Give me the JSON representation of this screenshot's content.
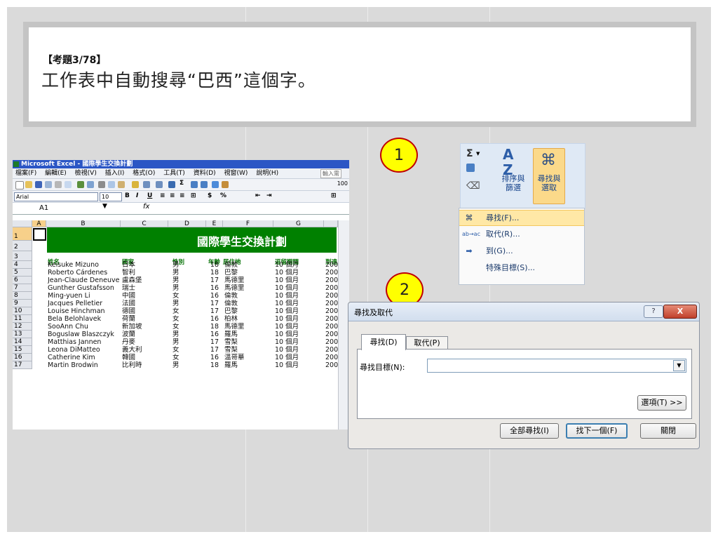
{
  "question": {
    "number": "【考題3/78】",
    "text": "工作表中自動搜尋“巴西”這個字。"
  },
  "callouts": [
    "1",
    "2"
  ],
  "excel": {
    "window_title": "Microsoft Excel - 國際學生交換計劃",
    "menu": [
      "檔案(F)",
      "編輯(E)",
      "檢視(V)",
      "插入(I)",
      "格式(O)",
      "工具(T)",
      "資料(D)",
      "視窗(W)",
      "說明(H)"
    ],
    "help_box": "輸入需",
    "zoom": "100",
    "font_name": "Arial",
    "font_size": "10",
    "name_box": "A1",
    "fx": "fx",
    "columns": [
      "A",
      "B",
      "C",
      "D",
      "E",
      "F",
      "G"
    ],
    "rows": [
      "1",
      "2",
      "3",
      "4",
      "5",
      "6",
      "7",
      "8",
      "9",
      "10",
      "11",
      "12",
      "13",
      "14",
      "15",
      "16",
      "17"
    ],
    "banner": "國際學生交換計劃",
    "headers": [
      "姓名",
      "國家",
      "性別",
      "年齡",
      "居住地",
      "逗留期間",
      "到達"
    ],
    "data": [
      [
        "Keisuke Mizuno",
        "日本",
        "男",
        "18",
        "倫敦",
        "10 個月",
        "200"
      ],
      [
        "Roberto Cárdenes",
        "智利",
        "男",
        "18",
        "巴黎",
        "10 個月",
        "200"
      ],
      [
        "Jean-Claude Deneuve",
        "盧森堡",
        "男",
        "17",
        "馬德里",
        "10 個月",
        "200"
      ],
      [
        "Gunther Gustafsson",
        "瑞士",
        "男",
        "16",
        "馬德里",
        "10 個月",
        "200"
      ],
      [
        "Ming-yuen Li",
        "中國",
        "女",
        "16",
        "倫敦",
        "10 個月",
        "200"
      ],
      [
        "Jacques Pelletier",
        "法國",
        "男",
        "17",
        "倫敦",
        "10 個月",
        "200"
      ],
      [
        "Louise Hinchman",
        "德國",
        "女",
        "17",
        "巴黎",
        "10 個月",
        "200"
      ],
      [
        "Bela Belohlavek",
        "荷蘭",
        "女",
        "16",
        "柏林",
        "10 個月",
        "200"
      ],
      [
        "SooAnn Chu",
        "新加坡",
        "女",
        "18",
        "馬德里",
        "10 個月",
        "200"
      ],
      [
        "Boguslaw Blaszczyk",
        "波蘭",
        "男",
        "16",
        "羅馬",
        "10 個月",
        "200"
      ],
      [
        "Matthias Jannen",
        "丹麥",
        "男",
        "17",
        "雪梨",
        "10 個月",
        "200"
      ],
      [
        "Leona DiMatteo",
        "義大利",
        "女",
        "17",
        "雪梨",
        "10 個月",
        "200"
      ],
      [
        "Catherine Kim",
        "韓國",
        "女",
        "16",
        "溫哥華",
        "10 個月",
        "200"
      ],
      [
        "Martin Brodwin",
        "比利時",
        "男",
        "18",
        "羅馬",
        "10 個月",
        "200"
      ]
    ]
  },
  "ribbon": {
    "sigma": "Σ",
    "sort_label_1": "排序與",
    "sort_label_2": "篩選",
    "find_label_1": "尋找與",
    "find_label_2": "選取",
    "menu_items": [
      "尋找(F)...",
      "取代(R)...",
      "到(G)...",
      "特殊目標(S)..."
    ]
  },
  "dialog": {
    "title": "尋找及取代",
    "help": "?",
    "close": "X",
    "tabs": [
      "尋找(D)",
      "取代(P)"
    ],
    "find_what_label": "尋找目標(N):",
    "find_what_value": "",
    "options_button": "選項(T) >>",
    "find_all_button": "全部尋找(I)",
    "find_next_button": "找下一個(F)",
    "close_button": "關閉"
  }
}
